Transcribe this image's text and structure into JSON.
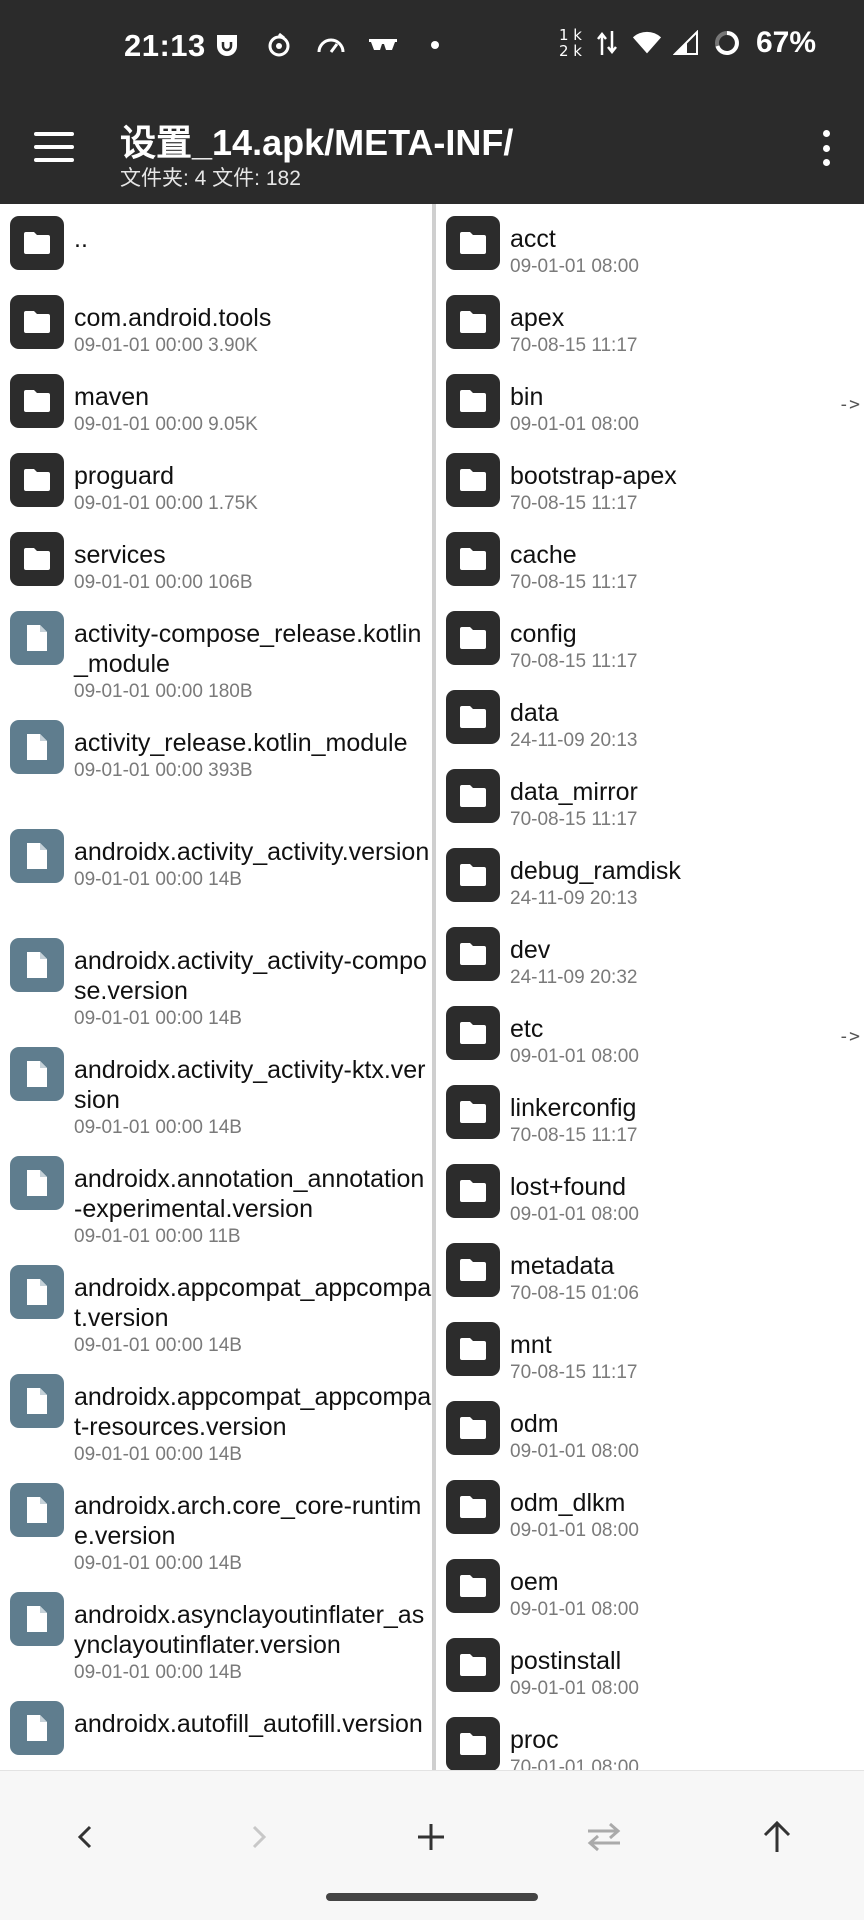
{
  "status_bar": {
    "time": "21:13",
    "speed_up": "1 k",
    "speed_down": "2 k",
    "battery": "67%"
  },
  "toolbar": {
    "title": "设置_14.apk/META-INF/",
    "subtitle": "文件夹: 4  文件: 182"
  },
  "left_pane": [
    {
      "name": "..",
      "meta": "",
      "type": "folder"
    },
    {
      "name": "com.android.tools",
      "meta": "09-01-01 00:00  3.90K",
      "type": "folder"
    },
    {
      "name": "maven",
      "meta": "09-01-01 00:00  9.05K",
      "type": "folder"
    },
    {
      "name": "proguard",
      "meta": "09-01-01 00:00  1.75K",
      "type": "folder"
    },
    {
      "name": "services",
      "meta": "09-01-01 00:00  106B",
      "type": "folder"
    },
    {
      "name": "activity-compose_release.kotlin_module",
      "meta": "09-01-01 00:00  180B",
      "type": "file"
    },
    {
      "name": "activity_release.kotlin_module",
      "meta": "09-01-01 00:00  393B",
      "type": "file"
    },
    {
      "name": "androidx.activity_activity.version",
      "meta": "09-01-01 00:00  14B",
      "type": "file"
    },
    {
      "name": "androidx.activity_activity-compose.version",
      "meta": "09-01-01 00:00  14B",
      "type": "file"
    },
    {
      "name": "androidx.activity_activity-ktx.version",
      "meta": "09-01-01 00:00  14B",
      "type": "file"
    },
    {
      "name": "androidx.annotation_annotation-experimental.version",
      "meta": "09-01-01 00:00  11B",
      "type": "file"
    },
    {
      "name": "androidx.appcompat_appcompat.version",
      "meta": "09-01-01 00:00  14B",
      "type": "file"
    },
    {
      "name": "androidx.appcompat_appcompat-resources.version",
      "meta": "09-01-01 00:00  14B",
      "type": "file"
    },
    {
      "name": "androidx.arch.core_core-runtime.version",
      "meta": "09-01-01 00:00  14B",
      "type": "file"
    },
    {
      "name": "androidx.asynclayoutinflater_asynclayoutinflater.version",
      "meta": "09-01-01 00:00  14B",
      "type": "file"
    },
    {
      "name": "androidx.autofill_autofill.version",
      "meta": "",
      "type": "file"
    }
  ],
  "right_pane": [
    {
      "name": "acct",
      "meta": "09-01-01 08:00",
      "link": ""
    },
    {
      "name": "apex",
      "meta": "70-08-15 11:17",
      "link": ""
    },
    {
      "name": "bin",
      "meta": "09-01-01 08:00",
      "link": "->"
    },
    {
      "name": "bootstrap-apex",
      "meta": "70-08-15 11:17",
      "link": ""
    },
    {
      "name": "cache",
      "meta": "70-08-15 11:17",
      "link": ""
    },
    {
      "name": "config",
      "meta": "70-08-15 11:17",
      "link": ""
    },
    {
      "name": "data",
      "meta": "24-11-09 20:13",
      "link": ""
    },
    {
      "name": "data_mirror",
      "meta": "70-08-15 11:17",
      "link": ""
    },
    {
      "name": "debug_ramdisk",
      "meta": "24-11-09 20:13",
      "link": ""
    },
    {
      "name": "dev",
      "meta": "24-11-09 20:32",
      "link": ""
    },
    {
      "name": "etc",
      "meta": "09-01-01 08:00",
      "link": "->"
    },
    {
      "name": "linkerconfig",
      "meta": "70-08-15 11:17",
      "link": ""
    },
    {
      "name": "lost+found",
      "meta": "09-01-01 08:00",
      "link": ""
    },
    {
      "name": "metadata",
      "meta": "70-08-15 01:06",
      "link": ""
    },
    {
      "name": "mnt",
      "meta": "70-08-15 11:17",
      "link": ""
    },
    {
      "name": "odm",
      "meta": "09-01-01 08:00",
      "link": ""
    },
    {
      "name": "odm_dlkm",
      "meta": "09-01-01 08:00",
      "link": ""
    },
    {
      "name": "oem",
      "meta": "09-01-01 08:00",
      "link": ""
    },
    {
      "name": "postinstall",
      "meta": "09-01-01 08:00",
      "link": ""
    },
    {
      "name": "proc",
      "meta": "70-01-01 08:00",
      "link": ""
    }
  ],
  "bottom_nav": {
    "icons": [
      "back-icon",
      "forward-icon",
      "add-icon",
      "swap-icon",
      "up-icon"
    ]
  },
  "colors": {
    "bar": "#2b2b2b",
    "folder_icon": "#2c2c2c",
    "file_icon": "#5f7d8e"
  }
}
